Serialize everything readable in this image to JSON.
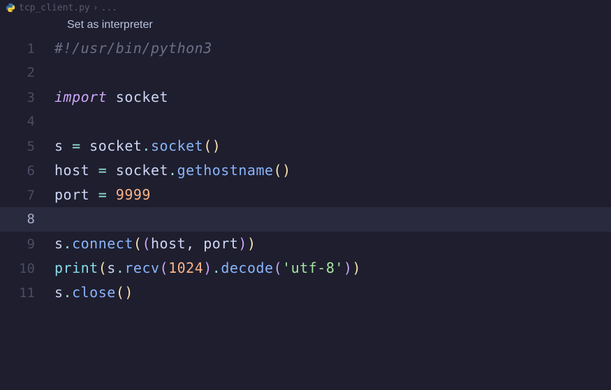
{
  "breadcrumb": {
    "filename": "tcp_client.py",
    "separator": "›",
    "ellipsis": "..."
  },
  "codelens": {
    "label": "Set as interpreter"
  },
  "lines": {
    "n1": "1",
    "n2": "2",
    "n3": "3",
    "n4": "4",
    "n5": "5",
    "n6": "6",
    "n7": "7",
    "n8": "8",
    "n9": "9",
    "n10": "10",
    "n11": "11"
  },
  "code": {
    "shebang": "#!/usr/bin/python3",
    "import_kw": "import",
    "socket_mod": " socket",
    "s_var": "s",
    "host_var": "host",
    "port_var": "port",
    "eq": " = ",
    "socket_ref": "socket",
    "dot": ".",
    "socket_fn": "socket",
    "gethostname_fn": "gethostname",
    "connect_fn": "connect",
    "print_fn": "print",
    "recv_fn": "recv",
    "decode_fn": "decode",
    "close_fn": "close",
    "lp": "(",
    "rp": ")",
    "comma": ", ",
    "port_num": "9999",
    "recv_num": "1024",
    "utf8_str": "'utf-8'"
  },
  "colors": {
    "bg": "#1e1e2e",
    "comment": "#6c7086",
    "keyword": "#cba6f7",
    "paren_yellow": "#f9e2af",
    "number": "#fab387",
    "string": "#a6e3a1",
    "function": "#89b4fa"
  }
}
